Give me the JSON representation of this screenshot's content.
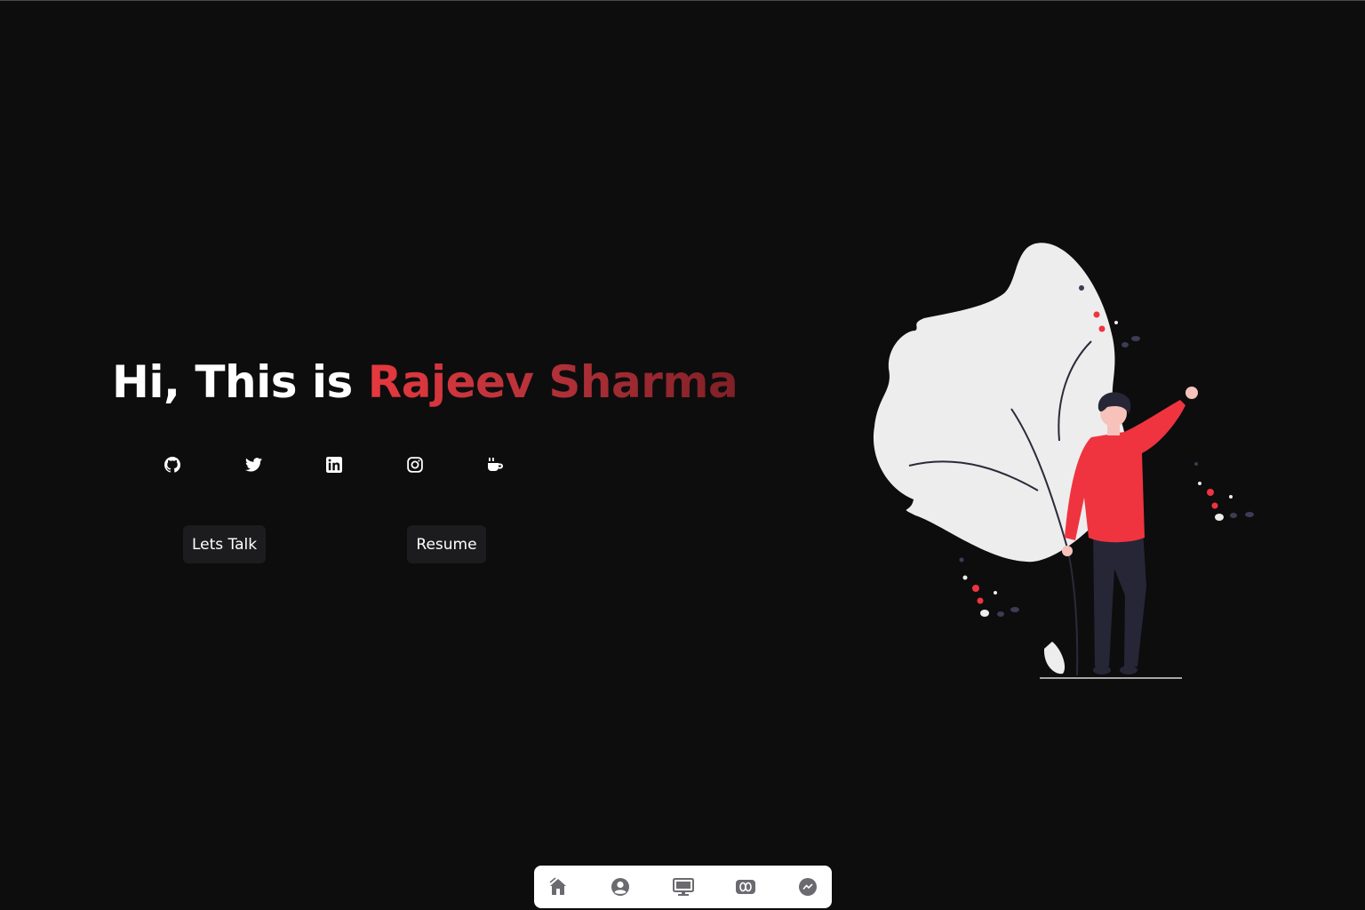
{
  "hero": {
    "greeting": "Hi, This is ",
    "name": "Rajeev Sharma"
  },
  "social": [
    {
      "icon": "github-icon"
    },
    {
      "icon": "twitter-icon"
    },
    {
      "icon": "linkedin-icon"
    },
    {
      "icon": "instagram-icon"
    },
    {
      "icon": "coffee-icon"
    }
  ],
  "buttons": {
    "lets_talk": "Lets Talk",
    "resume": "Resume"
  },
  "dock": [
    {
      "icon": "home-icon"
    },
    {
      "icon": "user-icon"
    },
    {
      "icon": "monitor-icon"
    },
    {
      "icon": "projects-icon"
    },
    {
      "icon": "messenger-icon"
    }
  ],
  "colors": {
    "background": "#0d0d0e",
    "accent": "#e6393e",
    "button_bg": "#1c1c1f",
    "dock_bg": "#ffffff",
    "dock_icon": "#6b6b6f"
  }
}
